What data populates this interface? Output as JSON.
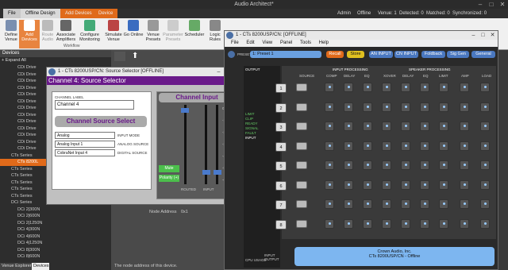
{
  "app": {
    "title": "Audio Architect*"
  },
  "tabs": [
    {
      "label": "File"
    },
    {
      "label": "Offline Design"
    },
    {
      "label": "Add Devices"
    },
    {
      "label": "Device"
    }
  ],
  "status": {
    "user": "Admin",
    "mode": "Offline",
    "venue": "Venue: 1",
    "detected": "Detected: 0",
    "matched": "Matched: 0",
    "synchronized": "Synchronized: 0"
  },
  "ribbon": {
    "buttons": [
      "Define Venue",
      "Add Devices",
      "Route Audio",
      "Associate Amplifiers",
      "Configure Monitoring",
      "Simulate Venue",
      "Go Online",
      "Venue Presets",
      "Parameter Presets",
      "Scheduler",
      "Logic Rules"
    ],
    "group": "Workflow"
  },
  "left": {
    "header": "Devices",
    "expand_all": "+ Expand All",
    "items": [
      "CDi Drive",
      "CDi Drive",
      "CDi Drive",
      "CDi Drive",
      "CDi Drive",
      "CDi Drive",
      "CDi Drive",
      "CDi Drive",
      "CDi Drive",
      "CDi Drive",
      "CDi Drive",
      "CDi Drive",
      "CDi Drive",
      "CTs Series",
      "CTs 8200L",
      "CTs Series",
      "CTs Series",
      "CTs Series",
      "CTs Series",
      "CTs Series",
      "DCi Series",
      "DCi 2|300N",
      "DCi 2|600N",
      "DCi 2|1250N",
      "DCi 4|300N",
      "DCi 4|600N",
      "DCi 4|1250N",
      "DCi 8|300N",
      "DCi 8|600N"
    ],
    "footer_tab1": "Venue Explorer",
    "footer_tab2": "Devices"
  },
  "center": {
    "node_label": "Node Address",
    "node_value": "0x1",
    "desc": "The node address of this device."
  },
  "source_win": {
    "title": "1 - CTs 8200USP/CN: Source Selector [OFFLINE]",
    "heading": "Channel 4: Source Selector",
    "channel_label_caption": "CHANNEL LABEL",
    "channel_label_value": "Channel 4",
    "css_title": "Channel Source Select",
    "input_mode_value": "Analog",
    "input_mode_label": "INPUT MODE",
    "analog_value": "Analog Input 1",
    "analog_label": "ANALOG SOURCE",
    "digital_value": "CobraNet Input 4",
    "digital_label": "DIGITAL SOURCE",
    "ci_title": "Channel Input",
    "mute": "Mute",
    "polarity": "Polarity (+)",
    "routed": "ROUTED",
    "input": "INPUT",
    "scale": [
      "0",
      "-10",
      "-20",
      "-30",
      "-40",
      "-50",
      "-60"
    ]
  },
  "main_win": {
    "title": "1 - CTs 8200USP/CN: [OFFLINE]",
    "menu": [
      "File",
      "Edit",
      "View",
      "Panel",
      "Tools",
      "Help"
    ],
    "preset_label": "PRESET",
    "preset_value": "1: Preset 1",
    "recall": "Recall",
    "store": "Store",
    "buttons": [
      "AN INPUT",
      "CN INPUT",
      "Foldback",
      "Sig Gen",
      "General"
    ],
    "output_lbl": "OUTPUT",
    "input_lbl": "INPUT",
    "cpu": "CPU USAGE",
    "input_output": "INPUT OUTPUT",
    "source_lbl": "SOURCE",
    "input_proc": "INPUT PROCESSING",
    "speaker_proc": "SPEAKER PROCESSING",
    "cols": [
      "COMP",
      "DELAY",
      "EQ",
      "XOVER",
      "DELAY",
      "EQ",
      "LIMIT",
      "AMP",
      "LOAD"
    ],
    "channels": [
      "1",
      "2",
      "3",
      "4",
      "5",
      "6",
      "7",
      "8"
    ],
    "footer1": "Crown Audio, Inc.",
    "footer2": "CTs 8200USP/CN - Offline",
    "status_lbls": [
      "LIMIT",
      "CLIP",
      "READY",
      "SIGNAL",
      "FAULT"
    ]
  }
}
